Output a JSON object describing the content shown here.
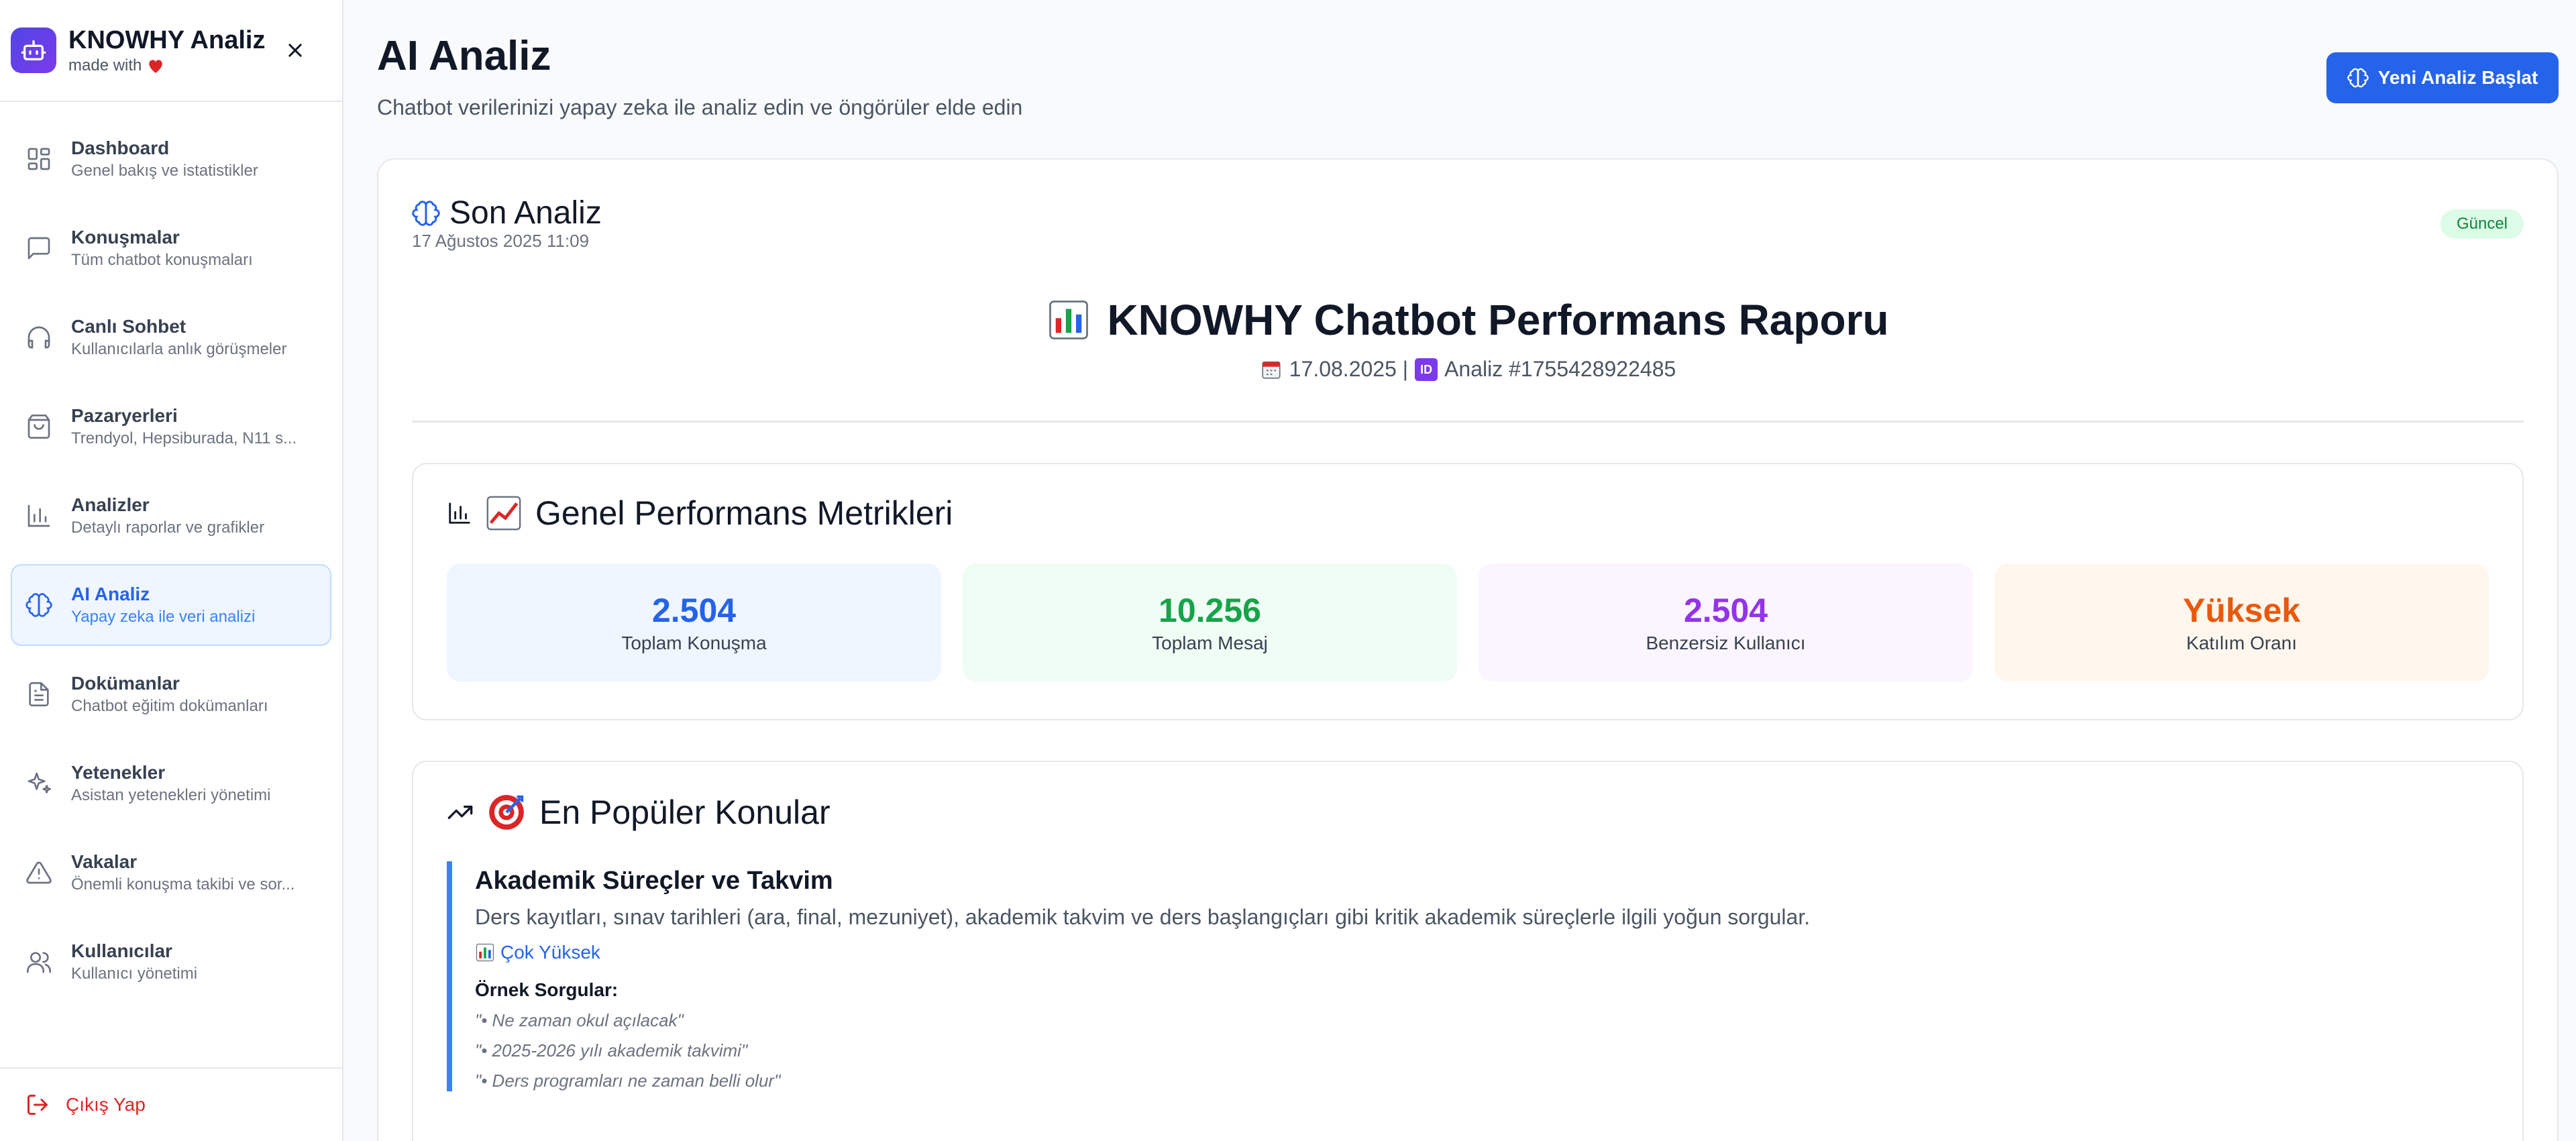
{
  "brand": {
    "title": "KNOWHY Analiz",
    "made_with": "made with"
  },
  "sidebar": {
    "items": [
      {
        "label": "Dashboard",
        "desc": "Genel bakış ve istatistikler",
        "icon": "dashboard-grid-icon"
      },
      {
        "label": "Konuşmalar",
        "desc": "Tüm chatbot konuşmaları",
        "icon": "chat-bubble-icon"
      },
      {
        "label": "Canlı Sohbet",
        "desc": "Kullanıcılarla anlık görüşmeler",
        "icon": "headphones-icon"
      },
      {
        "label": "Pazaryerleri",
        "desc": "Trendyol, Hepsiburada, N11 s...",
        "icon": "shopping-bag-icon"
      },
      {
        "label": "Analizler",
        "desc": "Detaylı raporlar ve grafikler",
        "icon": "bar-chart-icon"
      },
      {
        "label": "AI Analiz",
        "desc": "Yapay zeka ile veri analizi",
        "icon": "brain-icon",
        "active": true
      },
      {
        "label": "Dokümanlar",
        "desc": "Chatbot eğitim dokümanları",
        "icon": "document-icon"
      },
      {
        "label": "Yetenekler",
        "desc": "Asistan yetenekleri yönetimi",
        "icon": "sparkles-icon"
      },
      {
        "label": "Vakalar",
        "desc": "Önemli konuşma takibi ve sor...",
        "icon": "warning-triangle-icon"
      },
      {
        "label": "Kullanıcılar",
        "desc": "Kullanıcı yönetimi",
        "icon": "users-icon"
      }
    ],
    "logout": "Çıkış Yap"
  },
  "header": {
    "title": "AI Analiz",
    "subtitle": "Chatbot verilerinizi yapay zeka ile analiz edin ve öngörüler elde edin",
    "new_button": "Yeni Analiz Başlat"
  },
  "analysis": {
    "title": "Son Analiz",
    "date": "17 Ağustos 2025 11:09",
    "badge": "Güncel",
    "report_title": "KNOWHY Chatbot Performans Raporu",
    "report_date": "17.08.2025 |",
    "report_id": "Analiz #1755428922485"
  },
  "metrics": {
    "title": "Genel Performans Metrikleri",
    "items": [
      {
        "value": "2.504",
        "label": "Toplam Konuşma"
      },
      {
        "value": "10.256",
        "label": "Toplam Mesaj"
      },
      {
        "value": "2.504",
        "label": "Benzersiz Kullanıcı"
      },
      {
        "value": "Yüksek",
        "label": "Katılım Oranı"
      }
    ]
  },
  "topics": {
    "title": "En Popüler Konular",
    "items": [
      {
        "title": "Akademik Süreçler ve Takvim",
        "desc": "Ders kayıtları, sınav tarihleri (ara, final, mezuniyet), akademik takvim ve ders başlangıçları gibi kritik akademik süreçlerle ilgili yoğun sorgular.",
        "level": "Çok Yüksek",
        "samples_label": "Örnek Sorgular:",
        "samples": [
          "\"• Ne zaman okul açılacak\"",
          "\"• 2025-2026 yılı akademik takvimi\"",
          "\"• Ders programları ne zaman belli olur\""
        ]
      }
    ]
  },
  "colors": {
    "accent": "#2563eb",
    "active_bg": "#eff6ff",
    "logout": "#dc2626",
    "badge_bg": "#dcfce7"
  }
}
